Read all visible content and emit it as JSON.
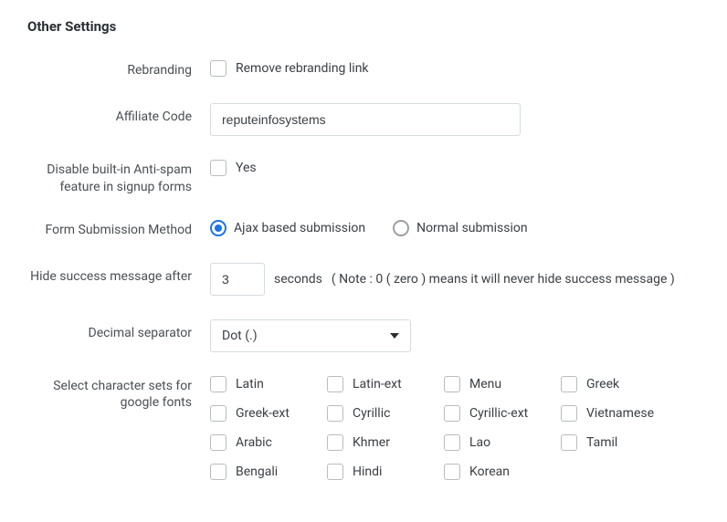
{
  "section_title": "Other Settings",
  "rebranding": {
    "label": "Rebranding",
    "checkbox_label": "Remove rebranding link"
  },
  "affiliate": {
    "label": "Affiliate Code",
    "value": "reputeinfosystems"
  },
  "antispam": {
    "label": "Disable built-in Anti-spam feature in signup forms",
    "checkbox_label": "Yes"
  },
  "submission": {
    "label": "Form Submission Method",
    "option_ajax": "Ajax based submission",
    "option_normal": "Normal submission"
  },
  "hide_success": {
    "label": "Hide success message after",
    "value": "3",
    "unit": "seconds",
    "note": "( Note : 0 ( zero ) means it will never hide success message )"
  },
  "decimal": {
    "label": "Decimal separator",
    "selected": "Dot (.)"
  },
  "charsets": {
    "label": "Select character sets for google fonts",
    "items": [
      [
        "Latin",
        "Latin-ext",
        "Menu",
        "Greek"
      ],
      [
        "Greek-ext",
        "Cyrillic",
        "Cyrillic-ext",
        "Vietnamese"
      ],
      [
        "Arabic",
        "Khmer",
        "Lao",
        "Tamil"
      ],
      [
        "Bengali",
        "Hindi",
        "Korean"
      ]
    ]
  }
}
